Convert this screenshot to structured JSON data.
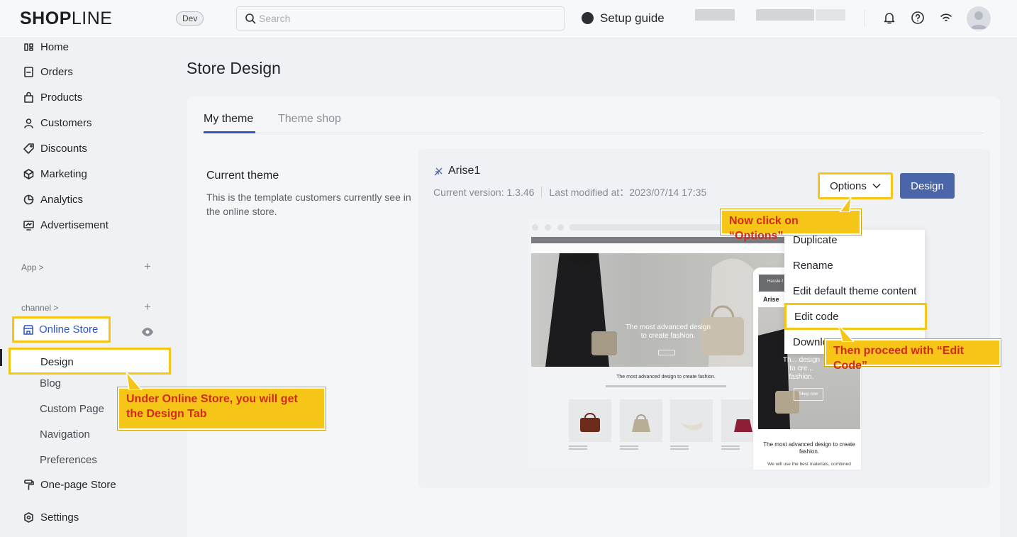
{
  "topbar": {
    "logo_bold": "SH",
    "logo_mark": "O",
    "logo_bold2": "P",
    "logo_thin": "LINE",
    "env_badge": "Dev",
    "search_placeholder": "Search",
    "setup_guide": "Setup guide",
    "icons": [
      "bell-icon",
      "help-icon",
      "wifi-icon",
      "avatar"
    ]
  },
  "sidebar": {
    "items": [
      {
        "label": "Home",
        "icon": "home-icon"
      },
      {
        "label": "Orders",
        "icon": "orders-icon"
      },
      {
        "label": "Products",
        "icon": "products-icon"
      },
      {
        "label": "Customers",
        "icon": "customers-icon"
      },
      {
        "label": "Discounts",
        "icon": "discounts-icon"
      },
      {
        "label": "Marketing",
        "icon": "marketing-icon"
      },
      {
        "label": "Analytics",
        "icon": "analytics-icon"
      },
      {
        "label": "Advertisement",
        "icon": "advertisement-icon"
      }
    ],
    "app_heading": "App >",
    "channel_heading": "channel >",
    "online_store": "Online Store",
    "sub_items": [
      "Design",
      "Blog",
      "Custom Page",
      "Navigation",
      "Preferences"
    ],
    "one_page_store": "One-page Store",
    "settings": "Settings"
  },
  "main": {
    "page_title": "Store Design",
    "tabs": [
      {
        "label": "My theme",
        "active": true
      },
      {
        "label": "Theme shop",
        "active": false
      }
    ],
    "current_theme_title": "Current theme",
    "current_theme_desc": "This is the template customers currently see in the online store.",
    "theme_name": "Arise1",
    "theme_version": "Current version: 1.3.46",
    "theme_modified": "Last modified at：2023/07/14 17:35",
    "options_label": "Options",
    "design_label": "Design",
    "dropdown": [
      "Duplicate",
      "Rename",
      "Edit default theme content",
      "Edit code",
      "Downlo"
    ],
    "preview": {
      "hero_text": "The most advanced design to create fashion.",
      "section_heading": "The most advanced design to create fashion.",
      "mobile_brand": "Arise",
      "mobile_bar": "Hassle-f",
      "mobile_hero": "Th... design to cre... fashion.",
      "mobile_shop": "Shop now",
      "mobile_heading": "The most advanced design to create fashion.",
      "mobile_text": "We will use the best materials, combined"
    }
  },
  "callouts": {
    "options": "Now click on “Options”",
    "edit_code": "Then proceed with “Edit Code”",
    "design_tab": "Under Online Store, you will get the Design Tab"
  },
  "colors": {
    "highlight": "#f5c518",
    "callout_text": "#d22b15",
    "primary": "#4a66a8",
    "link": "#2f55c9"
  }
}
